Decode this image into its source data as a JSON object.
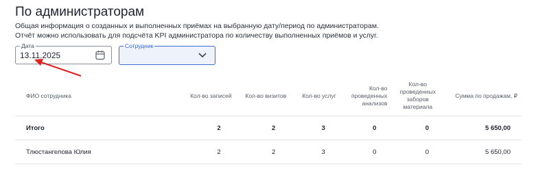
{
  "header": {
    "title": "По администраторам",
    "description_line1": "Общая информация о созданных и выполненных приёмах на выбранную дату/период по администраторам.",
    "description_line2": "Отчёт можно использовать для подсчёта KPI администратора по количеству выполненных приёмов и услуг."
  },
  "filters": {
    "date": {
      "label": "Дата",
      "value": "13.11.2025",
      "icon": "calendar-icon"
    },
    "staff": {
      "label": "Сотрудник",
      "value": "",
      "icon": "chevron-down-icon"
    }
  },
  "colors": {
    "accent": "#3d6ad6",
    "annotation_arrow": "#e02020",
    "border": "#e3e5ea"
  },
  "table": {
    "columns": [
      "ФИО сотрудника",
      "Кол-во записей",
      "Кол-во визитов",
      "Кол-во услуг",
      "Кол-во проведенных анализов",
      "Кол-во проведенных заборов материала",
      "Сумма по продажам, ₽"
    ],
    "total": [
      "Итого",
      "2",
      "2",
      "3",
      "0",
      "0",
      "5 650,00"
    ],
    "rows": [
      [
        "Тлюстангелова Юлия",
        "2",
        "2",
        "3",
        "0",
        "0",
        "5 650,00"
      ]
    ]
  }
}
